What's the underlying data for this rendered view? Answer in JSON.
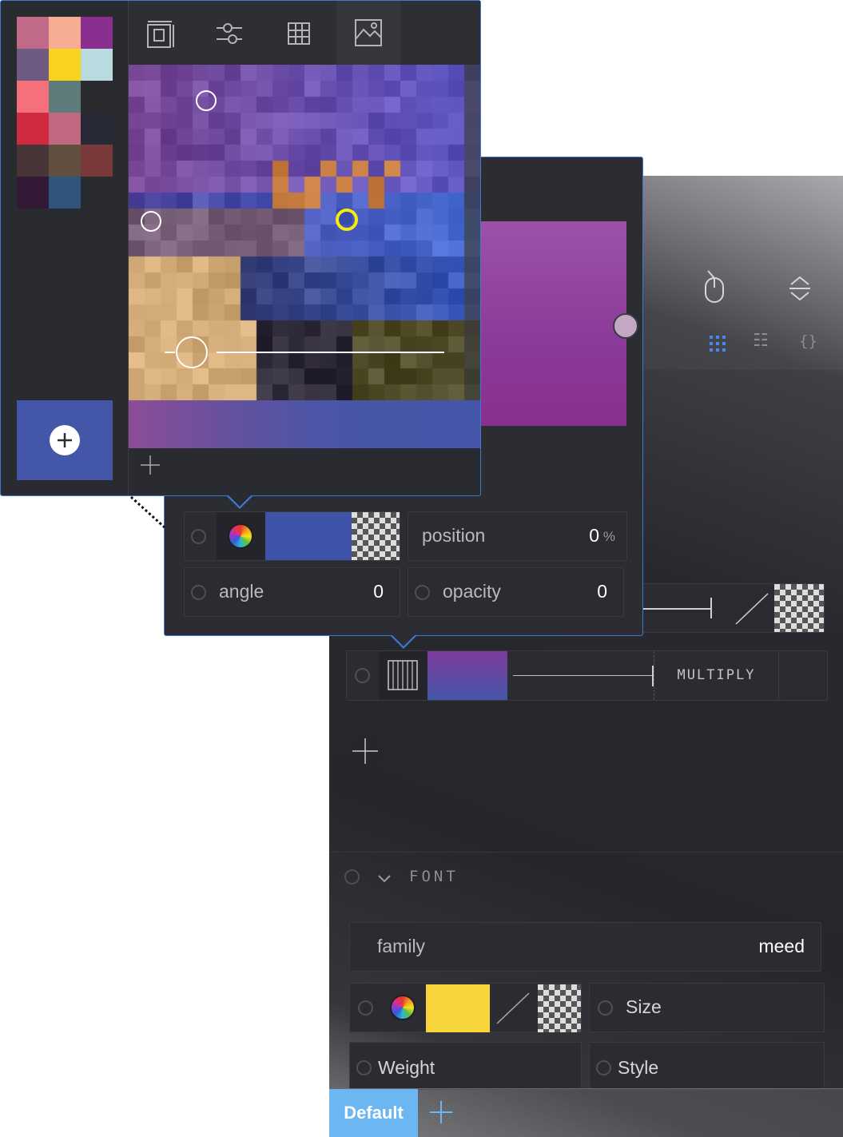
{
  "toolbar": {
    "tabs": [
      {
        "icon": "frame-photo-icon",
        "glyph": "⧉"
      },
      {
        "icon": "sliders-icon",
        "glyph": "⚟"
      },
      {
        "icon": "grid-icon",
        "glyph": "▦"
      },
      {
        "icon": "image-icon",
        "glyph": "⛰"
      }
    ],
    "add_glyph": "+"
  },
  "palette": {
    "swatches": [
      "#c06a88",
      "#f7ad92",
      "#8a2f90",
      "#6e5a83",
      "#f8d21e",
      "#b9dadf",
      "#f6707b",
      "#5e7a7a",
      "#2b2a2e",
      "#cf2a40",
      "#c06880",
      "#272a36",
      "#473538",
      "#615040",
      "#7a3a3c",
      "#321a36",
      "#30557b"
    ],
    "add_button_color": "#4356a8",
    "add_glyph": "+"
  },
  "gradient_stop": {
    "color": "#3f54a8",
    "position_label": "position",
    "position_value": "0",
    "position_unit": "%",
    "angle_label": "angle",
    "angle_value": "0",
    "opacity_label": "opacity",
    "opacity_value": "0"
  },
  "gradient_preview": {
    "color_top": "#9b52a8",
    "color_bottom": "#8a2f8e"
  },
  "layer": {
    "blend_mode": "MULTIPLY",
    "add_glyph": "+"
  },
  "font_section": {
    "title": "FONT",
    "family_label": "family",
    "family_value": "meed",
    "color": "#f8d53a",
    "size_label": "Size",
    "weight_label": "Weight",
    "style_label": "Style"
  },
  "footer": {
    "default_tab": "Default",
    "add_glyph": "+"
  },
  "icons": {
    "mouse": "mouse-icon",
    "resize": "resize-vertical-icon",
    "grid_view": "grid-view-icon",
    "list_view": "list-view-icon",
    "code_view": "code-view-icon",
    "list_glyph": "☷",
    "code_glyph": "{}"
  }
}
